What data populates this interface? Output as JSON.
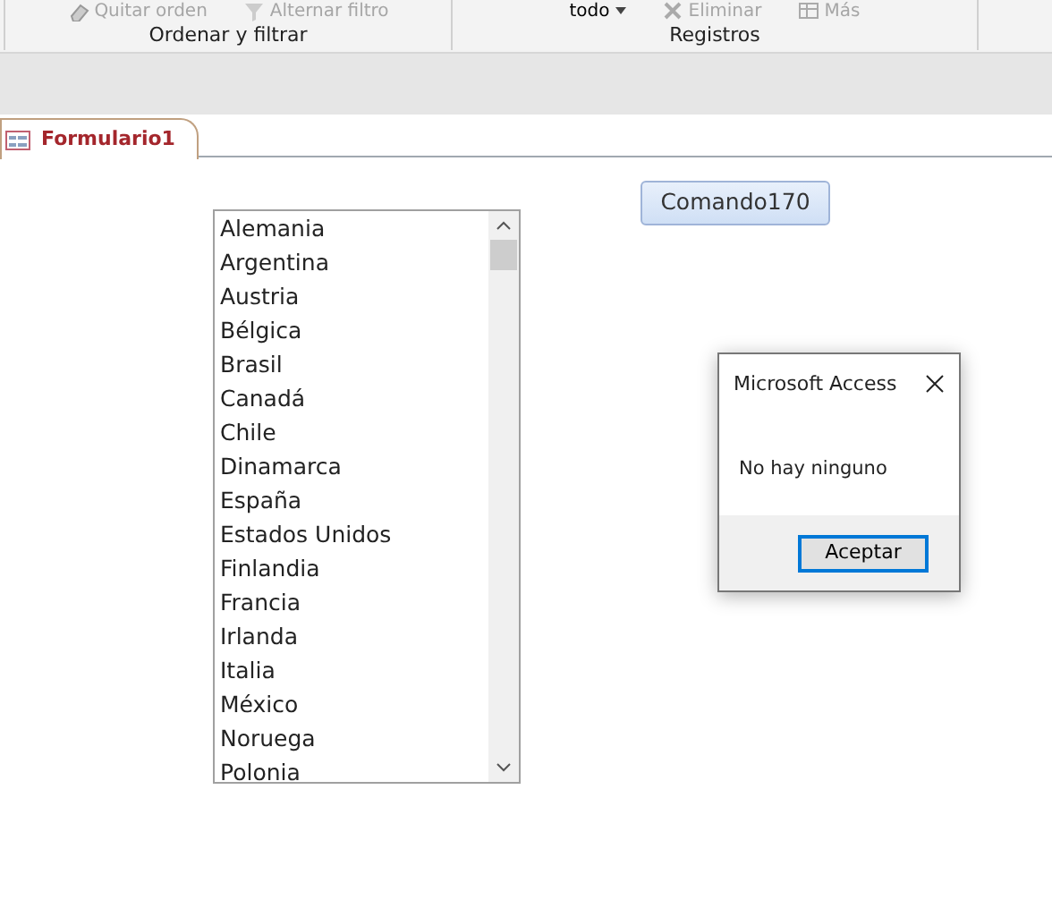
{
  "ribbon": {
    "groups": [
      {
        "label": "Ordenar y filtrar",
        "commands": [
          {
            "label": "Quitar orden",
            "kind": "eraser",
            "disabled": true
          },
          {
            "label": "Alternar filtro",
            "kind": "funnel",
            "disabled": true
          }
        ]
      },
      {
        "label": "Registros",
        "commands": [
          {
            "label": "todo",
            "kind": "dropdown",
            "disabled": false
          },
          {
            "label": "Eliminar",
            "kind": "delete",
            "disabled": true
          },
          {
            "label": "Más",
            "kind": "grid",
            "disabled": true
          }
        ]
      }
    ]
  },
  "document_tabs": [
    {
      "label": "Formulario1",
      "selected": true
    }
  ],
  "form": {
    "listbox": {
      "items": [
        "Alemania",
        "Argentina",
        "Austria",
        "Bélgica",
        "Brasil",
        "Canadá",
        "Chile",
        "Dinamarca",
        "España",
        "Estados Unidos",
        "Finlandia",
        "Francia",
        "Irlanda",
        "Italia",
        "México",
        "Noruega",
        "Polonia"
      ]
    },
    "button": {
      "label": "Comando170"
    }
  },
  "dialog": {
    "title": "Microsoft Access",
    "message": "No hay ninguno",
    "button": "Aceptar"
  }
}
